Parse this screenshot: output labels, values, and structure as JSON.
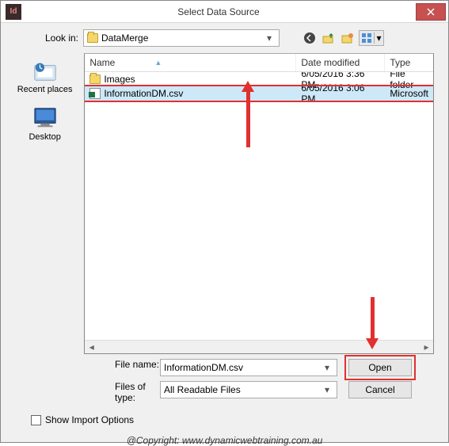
{
  "window": {
    "title": "Select Data Source"
  },
  "lookin": {
    "label": "Look in:",
    "value": "DataMerge"
  },
  "places": [
    {
      "label": "Recent places"
    },
    {
      "label": "Desktop"
    }
  ],
  "columns": {
    "name": "Name",
    "date": "Date modified",
    "type": "Type"
  },
  "files": [
    {
      "icon": "folder",
      "name": "Images",
      "date": "6/05/2016 3:36 PM",
      "type": "File folder",
      "selected": false
    },
    {
      "icon": "csv",
      "name": "InformationDM.csv",
      "date": "6/05/2016 3:06 PM",
      "type": "Microsoft",
      "selected": true
    }
  ],
  "filename": {
    "label": "File name:",
    "value": "InformationDM.csv"
  },
  "filetype": {
    "label": "Files of type:",
    "value": "All Readable Files"
  },
  "buttons": {
    "open": "Open",
    "cancel": "Cancel"
  },
  "checkbox": {
    "label": "Show Import Options",
    "checked": false
  },
  "copyright": "@Copyright: www.dynamicwebtraining.com.au"
}
